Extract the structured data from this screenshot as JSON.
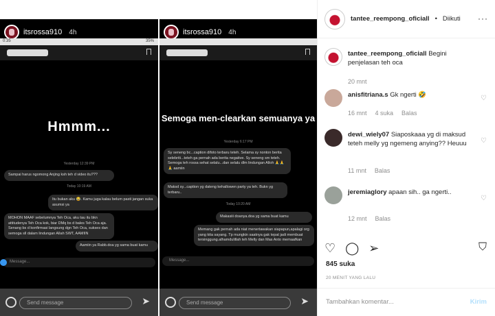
{
  "story1": {
    "username": "itsrossa910",
    "time": "4h",
    "status_left": "0:35",
    "status_right": "35%",
    "headline": "Hmmm...",
    "ts1": "Yesterday 12:39 PM",
    "msg1": "Sampai harus ngomong Anjing ksh teh d video itu???",
    "ts2": "Today 10:19 AM",
    "msg2": "Itu bukan aku 😂. Kamu juga kalau belum pasti jangan suka asumsi ya",
    "msg3": "MOHON MAAF sebelumnya Teh Oca, aku tau itu bkn attitudenya Teh Oca kok, biar DMq bs d bales Teh Oca aja. Senang bs d konfirmasi langsung dgn Teh Oca, sukses dan semoga sll dalam lindungan Allah SWT, AAMIIN",
    "msg4": "Aamiin ya Rabb.doa yg sama buat kamu",
    "input_placeholder": "Message...",
    "send_placeholder": "Send message"
  },
  "story2": {
    "username": "itsrossa910",
    "time": "4h",
    "headline": "Semoga men-clearkan semuanya ya",
    "ts1": "Yesterday 6:17 PM",
    "msg1": "Sy seneng bc...caption difoto terbaru teteh. Selama sy nonton berita selebriti...teteh ga pernah ada berita negative. Sy seneng sm teteh. Semoga teh rossa sehat selalu...dan selalu dlm lindungan Alloh 🙏🙏🙏 aamiin",
    "msg2": "Maksd sy...caption yg dateng kehallowen party ya teh. Bukn yg terbaru..",
    "ts2": "Today 10:20 AM",
    "msg3": "Makasiii doanya.doa yg sama buat kamu",
    "msg4": "Memang gak pernah ada niat menertawakan siapapun,apalagi org yang kita sayang. Tp mungkin saatnya gak tepat jadi membuat tersinggung.alhamdulillah teh Melly dan Mas Anto memaafkan",
    "input_placeholder": "Message...",
    "send_placeholder": "Send message"
  },
  "header": {
    "username": "tantee_reempong_oficiall",
    "separator": "•",
    "follow_status": "Diikuti",
    "more_icon": "···"
  },
  "caption": {
    "username": "tantee_reempong_oficiall",
    "text": "Begini penjelasan teh oca",
    "time": "20 mnt"
  },
  "comments": [
    {
      "username": "anisfitriana.s",
      "text": "Gk ngerti 🤣",
      "time": "16 mnt",
      "likes": "4 suka",
      "reply": "Balas"
    },
    {
      "username": "dewi_wiely07",
      "text": "Siaposkaaa yg di maksud teteh melly yg ngemeng anying?? Heuuu",
      "time": "11 mnt",
      "reply": "Balas"
    },
    {
      "username": "jeremiaglory",
      "text": "apaan sih.. ga ngerti..",
      "time": "12 mnt",
      "reply": "Balas"
    }
  ],
  "likes": "845 suka",
  "date": "20 MENIT YANG LALU",
  "add_comment": {
    "placeholder": "Tambahkan komentar...",
    "post_label": "Kirim"
  }
}
